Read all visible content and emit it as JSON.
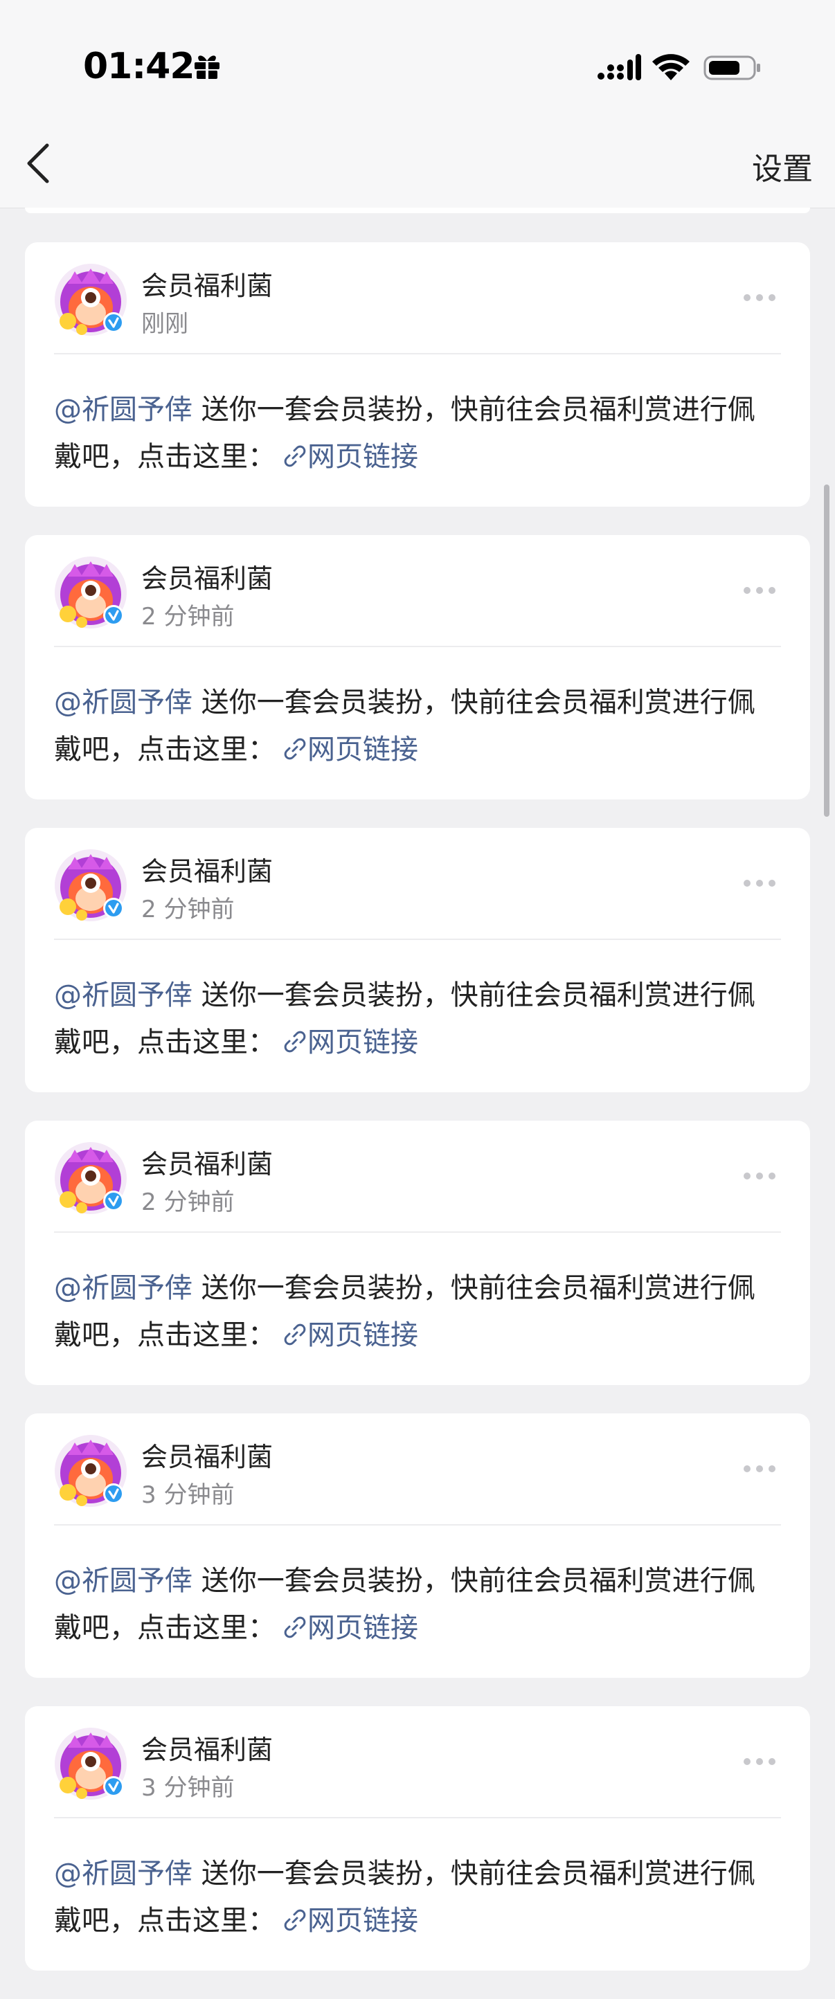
{
  "status_bar": {
    "time": "01:42",
    "icons": [
      "gift-icon",
      "cellular-signal-icon",
      "wifi-icon",
      "battery-icon"
    ]
  },
  "nav": {
    "back_icon": "chevron-left-icon",
    "settings_label": "设置"
  },
  "colors": {
    "mention": "#4a6290",
    "link": "#4a6290",
    "background": "#f0f0f2",
    "verified_badge": "#2d9cf0"
  },
  "messages": [
    {
      "sender": "会员福利菌",
      "time": "刚刚",
      "mention": "@祈圆予倖",
      "text": " 送你一套会员装扮，快前往会员福利赏进行佩戴吧，点击这里：",
      "link": "网页链接"
    },
    {
      "sender": "会员福利菌",
      "time": "2 分钟前",
      "mention": "@祈圆予倖",
      "text": " 送你一套会员装扮，快前往会员福利赏进行佩戴吧，点击这里：",
      "link": "网页链接"
    },
    {
      "sender": "会员福利菌",
      "time": "2 分钟前",
      "mention": "@祈圆予倖",
      "text": " 送你一套会员装扮，快前往会员福利赏进行佩戴吧，点击这里：",
      "link": "网页链接"
    },
    {
      "sender": "会员福利菌",
      "time": "2 分钟前",
      "mention": "@祈圆予倖",
      "text": " 送你一套会员装扮，快前往会员福利赏进行佩戴吧，点击这里：",
      "link": "网页链接"
    },
    {
      "sender": "会员福利菌",
      "time": "3 分钟前",
      "mention": "@祈圆予倖",
      "text": " 送你一套会员装扮，快前往会员福利赏进行佩戴吧，点击这里：",
      "link": "网页链接"
    },
    {
      "sender": "会员福利菌",
      "time": "3 分钟前",
      "mention": "@祈圆予倖",
      "text": " 送你一套会员装扮，快前往会员福利赏进行佩戴吧，点击这里：",
      "link": "网页链接"
    }
  ]
}
